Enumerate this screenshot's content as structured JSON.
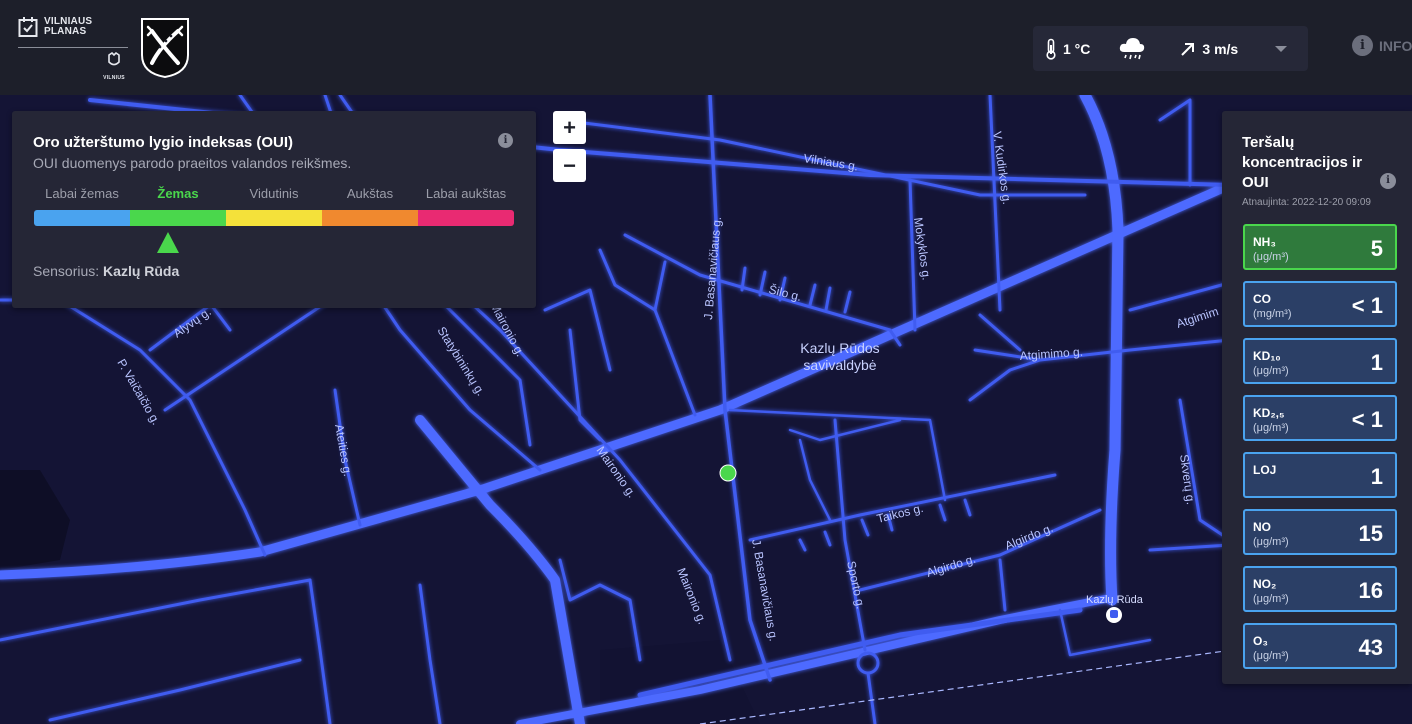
{
  "header": {
    "logo_text_line1": "VILNIAUS",
    "logo_text_line2": "PLANAS",
    "logo_city": "VILNIUS",
    "weather": {
      "temperature": "1 °C",
      "weather_icon": "rain-cloud-icon",
      "wind": "3 m/s",
      "wind_icon": "arrow-up-right-icon"
    },
    "info_label": "INFO"
  },
  "oui_panel": {
    "title": "Oro užterštumo lygio indeksas (OUI)",
    "subtitle": "OUI duomenys parodo praeitos valandos reikšmes.",
    "levels": [
      {
        "label": "Labai žemas",
        "color": "#4aa3ef"
      },
      {
        "label": "Žemas",
        "color": "#4ad74c"
      },
      {
        "label": "Vidutinis",
        "color": "#f4e13a"
      },
      {
        "label": "Aukštas",
        "color": "#f0892f"
      },
      {
        "label": "Labai aukštas",
        "color": "#e92a72"
      }
    ],
    "active_level_index": 1,
    "sensor_label": "Sensorius:",
    "sensor_name": "Kazlų Rūda"
  },
  "zoom": {
    "in_label": "+",
    "out_label": "−"
  },
  "map": {
    "labels": {
      "vilniaus": "Vilniaus g.",
      "basanaviciaus_top": "J. Basanavičiaus g.",
      "basanaviciaus_bottom": "J. Basanavičiaus g.",
      "kudirkos": "V. Kudirkos g.",
      "mokyklos": "Mokyklos g.",
      "silo": "Šilo g.",
      "maironio_top": "Maironio g.",
      "maironio_mid": "Maironio g.",
      "maironio_bottom": "Maironio g.",
      "statybininku": "Statybininkų g.",
      "alyvu": "Alyvų g.",
      "vaicaicio": "P. Vaičaičio g.",
      "ateities": "Ateities g.",
      "atgimimo": "Atgimimo g.",
      "atgimimo_right": "Atgimim",
      "taikos": "Taikos g.",
      "algirdo1": "Algirdo g.",
      "algirdo2": "Algirdo g.",
      "sporto": "Sporto g.",
      "skveru": "Skverų g.",
      "municipality_1": "Kazlų Rūdos",
      "municipality_2": "savivaldybė",
      "station": "Kazlų Rūda"
    },
    "sensor_marker_color": "#4ad74c"
  },
  "pollutants_panel": {
    "title": "Teršalų koncentracijos ir OUI",
    "updated": "Atnaujinta: 2022-12-20 09:09",
    "items": [
      {
        "name": "NH₃",
        "unit": "(μg/m³)",
        "value": "5",
        "status": "good"
      },
      {
        "name": "CO",
        "unit": "(mg/m³)",
        "value": "< 1",
        "status": "very-low"
      },
      {
        "name": "KD₁₀",
        "unit": "(μg/m³)",
        "value": "1",
        "status": "very-low"
      },
      {
        "name": "KD₂,₅",
        "unit": "(μg/m³)",
        "value": "< 1",
        "status": "very-low"
      },
      {
        "name": "LOJ",
        "unit": "",
        "value": "1",
        "status": "very-low"
      },
      {
        "name": "NO",
        "unit": "(μg/m³)",
        "value": "15",
        "status": "very-low"
      },
      {
        "name": "NO₂",
        "unit": "(μg/m³)",
        "value": "16",
        "status": "very-low"
      },
      {
        "name": "O₃",
        "unit": "(μg/m³)",
        "value": "43",
        "status": "very-low"
      }
    ]
  }
}
